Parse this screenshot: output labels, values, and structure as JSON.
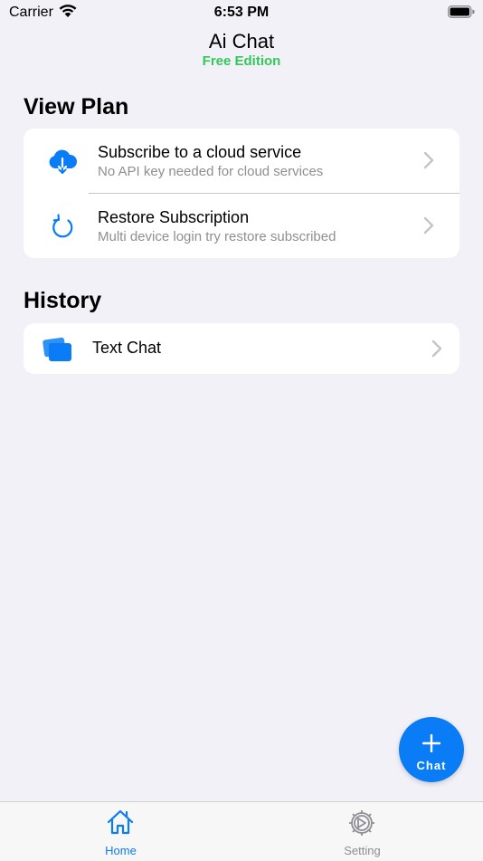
{
  "status_bar": {
    "carrier": "Carrier",
    "time": "6:53 PM"
  },
  "nav": {
    "title": "Ai Chat",
    "subtitle": "Free Edition"
  },
  "view_plan": {
    "heading": "View Plan",
    "items": [
      {
        "icon": "cloud-download-icon",
        "title": "Subscribe to a cloud service",
        "subtitle": "No API key needed for cloud services"
      },
      {
        "icon": "refresh-icon",
        "title": "Restore Subscription",
        "subtitle": "Multi device login try restore subscribed"
      }
    ]
  },
  "history": {
    "heading": "History",
    "items": [
      {
        "icon": "chat-cards-icon",
        "title": "Text Chat"
      }
    ]
  },
  "fab": {
    "label": "Chat"
  },
  "tab_bar": {
    "tabs": [
      {
        "label": "Home",
        "icon": "house-icon",
        "active": true
      },
      {
        "label": "Setting",
        "icon": "gear-icon",
        "active": false
      }
    ]
  },
  "colors": {
    "accent": "#0a7cf5",
    "edition_green": "#34c759",
    "background": "#f2f1f7",
    "secondary_text": "#8e8e93",
    "inactive_tab": "#8e8e93"
  }
}
